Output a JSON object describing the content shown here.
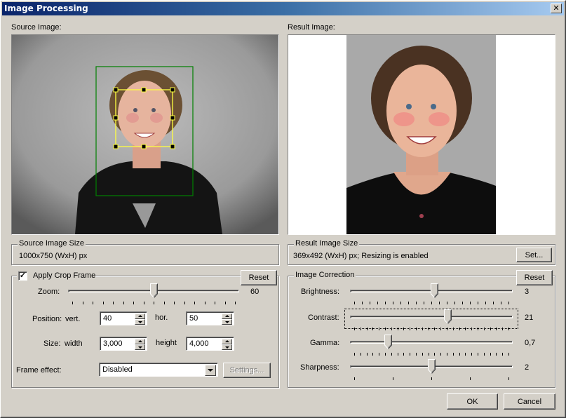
{
  "window": {
    "title": "Image Processing",
    "close_label": "✕"
  },
  "source": {
    "label": "Source Image:",
    "size_group_title": "Source Image Size",
    "size_text": "1000x750 (WxH) px"
  },
  "result": {
    "label": "Result Image:",
    "size_group_title": "Result Image Size",
    "size_text": "369x492 (WxH) px; Resizing is enabled",
    "set_button": "Set..."
  },
  "crop": {
    "checkbox_label": "Apply Crop Frame",
    "checked": true,
    "check_mark": "✓",
    "reset_button": "Reset",
    "zoom": {
      "label": "Zoom:",
      "value": "60",
      "fraction": 0.5,
      "ticks": 17
    },
    "position": {
      "label": "Position:",
      "vert_label": "vert.",
      "vert_value": "40",
      "hor_label": "hor.",
      "hor_value": "50"
    },
    "size": {
      "label": "Size:",
      "width_label": "width",
      "width_value": "3,000",
      "height_label": "height",
      "height_value": "4,000"
    },
    "frame_effect": {
      "label": "Frame effect:",
      "selected": "Disabled",
      "settings_button": "Settings..."
    }
  },
  "correction": {
    "group_title": "Image Correction",
    "reset_button": "Reset",
    "sliders": [
      {
        "name": "brightness",
        "label": "Brightness:",
        "value": "3",
        "fraction": 0.52,
        "ticks": 21
      },
      {
        "name": "contrast",
        "label": "Contrast:",
        "value": "21",
        "fraction": 0.605,
        "ticks": 26
      },
      {
        "name": "gamma",
        "label": "Gamma:",
        "value": "0,7",
        "fraction": 0.22,
        "ticks": 26
      },
      {
        "name": "sharpness",
        "label": "Sharpness:",
        "value": "2",
        "fraction": 0.5,
        "ticks": 5
      }
    ]
  },
  "footer": {
    "ok_button": "OK",
    "cancel_button": "Cancel"
  },
  "colors": {
    "crop_frame": "#008000",
    "face_frame": "#ffff40",
    "titlebar_start": "#0a246a",
    "titlebar_end": "#a6caf0"
  }
}
